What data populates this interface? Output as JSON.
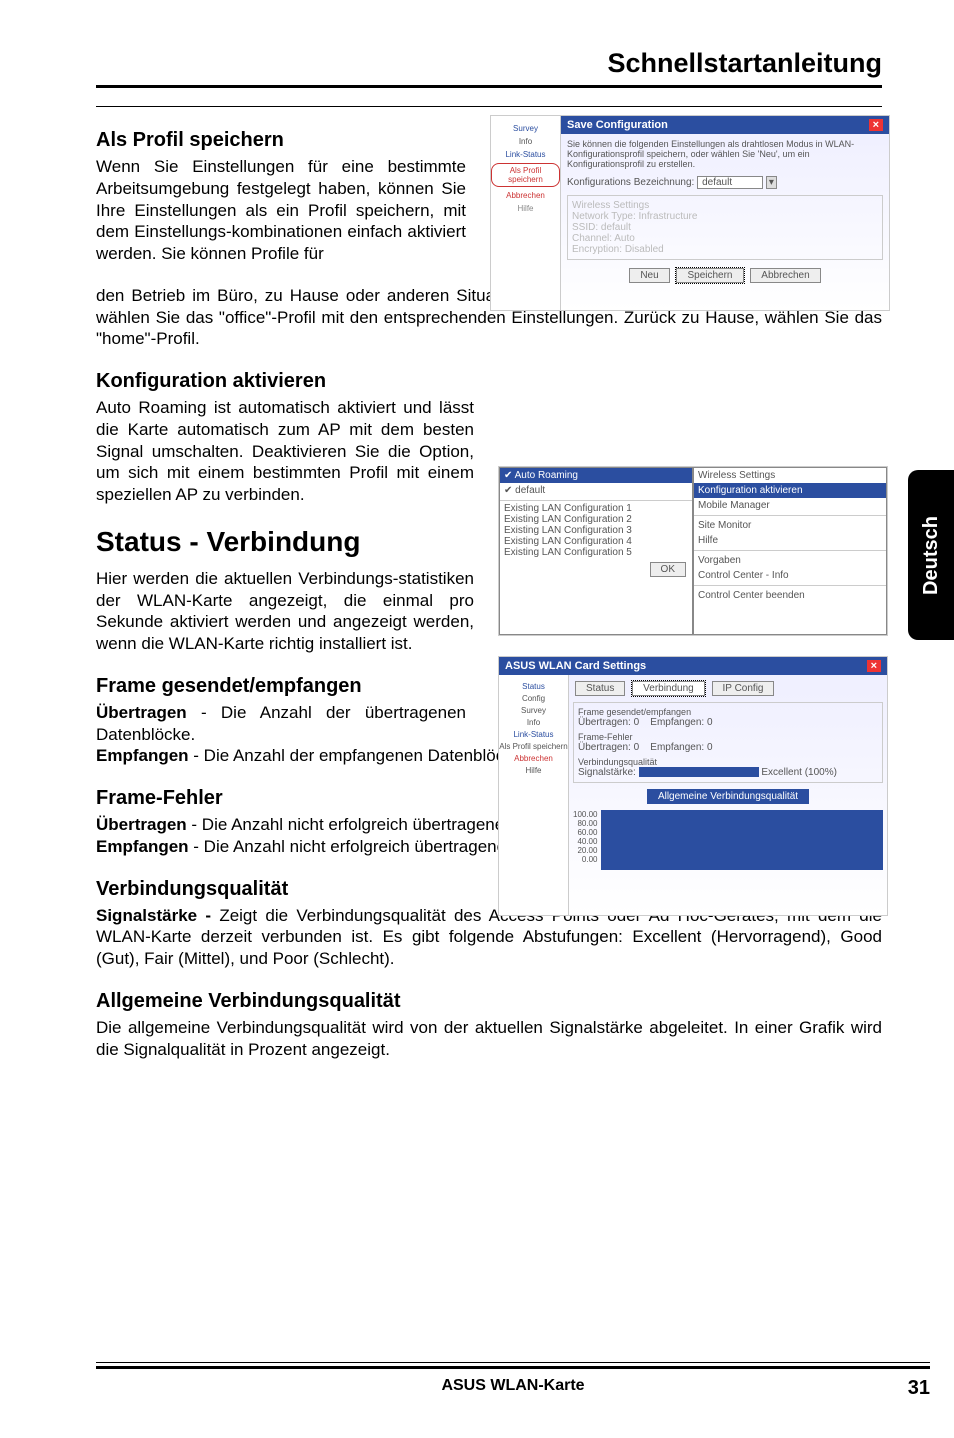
{
  "header": {
    "title": "Schnellstartanleitung"
  },
  "sidebar": {
    "language": "Deutsch"
  },
  "sections": {
    "save_profile": {
      "heading": "Als Profil speichern",
      "para1": "Wenn Sie Einstellungen für eine bestimmte Arbeitsumgebung festgelegt haben, können Sie Ihre Einstellungen als ein Profil speichern, mit dem Einstellungs-kombinationen einfach aktiviert werden. Sie können Profile für",
      "para2": "den Betrieb im Büro, zu Hause oder anderen Situationen erstellen. Wenn Sie sich im Büro befinden, wählen Sie das \"office\"-Profil mit den entsprechenden Einstellungen. Zurück zu Hause, wählen Sie das \"home\"-Profil."
    },
    "activate_config": {
      "heading": "Konfiguration aktivieren",
      "para": "Auto Roaming ist automatisch aktiviert und lässt die Karte automatisch zum AP mit dem besten Signal umschalten. Deaktivieren Sie die Option, um sich mit einem bestimmten Profil mit einem speziellen AP zu verbinden."
    },
    "status_conn": {
      "heading": "Status - Verbindung",
      "para": "Hier werden die aktuellen Verbindungs-statistiken der WLAN-Karte angezeigt, die einmal pro Sekunde aktiviert werden und angezeigt werden, wenn die WLAN-Karte richtig installiert ist."
    },
    "frame_sr": {
      "heading": "Frame gesendet/empfangen",
      "line1_bold": "Übertragen",
      "line1_rest": " - Die Anzahl der übertragenen Datenblöcke.",
      "line2_bold": "Empfangen",
      "line2_rest": " - Die Anzahl der empfangenen Datenblöcke."
    },
    "frame_err": {
      "heading": "Frame-Fehler",
      "line1_bold": "Übertragen",
      "line1_rest": " - Die Anzahl nicht erfolgreich übertragener Datenblöcke.",
      "line2_bold": "Empfangen",
      "line2_rest": " - Die Anzahl nicht erfolgreich übertragener Datenblöcke."
    },
    "conn_quality": {
      "heading": "Verbindungsqualität",
      "bold": "Signalstärke -",
      "rest": " Zeigt die Verbindungsqualität des Access Points oder Ad Hoc-Gerätes, mit dem die WLAN-Karte derzeit verbunden ist. Es gibt folgende Abstufungen: Excellent (Hervorragend), Good (Gut), Fair (Mittel), und Poor (Schlecht)."
    },
    "overall_quality": {
      "heading": "Allgemeine Verbindungsqualität",
      "para": "Die allgemeine Verbindungsqualität wird von der aktuellen Signalstärke abgeleitet. In einer Grafik wird die Signalqualität in Prozent angezeigt."
    }
  },
  "dialog1": {
    "title": "Save Configuration",
    "desc": "Sie können die folgenden Einstellungen als drahtlosen Modus in WLAN-Konfigurationsprofil speichern, oder wählen Sie 'Neu', um ein Konfigurationsprofil zu erstellen.",
    "field_label": "Konfigurations Bezeichnung:",
    "field_value": "default",
    "group_label": "Wireless Settings",
    "rows": {
      "network_type": "Network Type:",
      "network_type_v": "Infrastructure",
      "ssid": "SSID:",
      "ssid_v": "default",
      "channel": "Channel:",
      "channel_v": "Auto",
      "encryption": "Encryption:",
      "encryption_v": "Disabled"
    },
    "buttons": {
      "new": "Neu",
      "save": "Speichern",
      "cancel": "Abbrechen"
    },
    "left_icons": [
      "Survey",
      "Info",
      "Link-Status",
      "Als Profil speichern",
      "Abbrechen",
      "Hilfe"
    ]
  },
  "dialog2": {
    "menu_title": "Wireless Settings",
    "auto_roaming": "Auto Roaming",
    "default": "default",
    "items": [
      "Existing LAN Configuration 1",
      "Existing LAN Configuration 2",
      "Existing LAN Configuration 3",
      "Existing LAN Configuration 4",
      "Existing LAN Configuration 5"
    ],
    "right_items": [
      "Konfiguration aktivieren",
      "Mobile Manager",
      "Site Monitor",
      "Hilfe",
      "Vorgaben",
      "Control Center - Info",
      "Control Center beenden"
    ],
    "ok": "OK"
  },
  "dialog3": {
    "title": "ASUS WLAN Card Settings",
    "tabs": [
      "Status",
      "Verbindung",
      "IP Config"
    ],
    "group_frame": "Frame gesendet/empfangen",
    "tx_label": "Übertragen:",
    "rx_label": "Empfangen:",
    "group_err": "Frame-Fehler",
    "group_quality": "Verbindungsqualität",
    "signal_label": "Signalstärke:",
    "quality_value": "Excellent (100%)",
    "overall_label": "Allgemeine Verbindungsqualität",
    "left_icons": [
      "Status",
      "Config",
      "Survey",
      "Info",
      "Link-Status",
      "Als Profil speichern",
      "Abbrechen",
      "Hilfe"
    ],
    "bars": [
      "100.00",
      "80.00",
      "60.00",
      "40.00",
      "20.00",
      "0.00"
    ]
  },
  "footer": {
    "center": "ASUS WLAN-Karte",
    "page": "31"
  }
}
